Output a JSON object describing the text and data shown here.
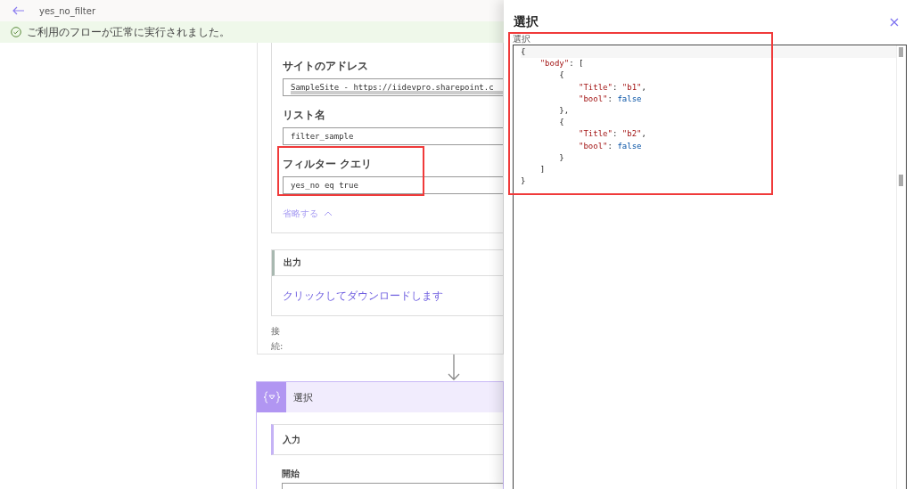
{
  "header": {
    "title": "yes_no_filter"
  },
  "banner": {
    "text": "ご利用のフローが正常に実行されました。"
  },
  "action_card": {
    "fields": [
      {
        "label": "サイトのアドレス",
        "value": "SampleSite - https://iidevpro.sharepoint.c",
        "highlighted": false,
        "scrollbar": true
      },
      {
        "label": "リスト名",
        "value": "filter_sample",
        "highlighted": false,
        "scrollbar": false
      },
      {
        "label": "フィルター クエリ",
        "value": "yes_no eq true",
        "highlighted": true,
        "scrollbar": false
      }
    ],
    "collapse_link": "省略する",
    "output": {
      "title": "出力",
      "link": "クリックしてダウンロードします"
    },
    "connection_label": "接続:"
  },
  "select_card": {
    "title": "選択",
    "input_title": "入力",
    "start_label": "開始"
  },
  "panel": {
    "title": "選択",
    "editor_label": "選択",
    "highlighted": true,
    "lines": [
      [
        {
          "kind": "punct",
          "text": "{"
        }
      ],
      [
        {
          "kind": "key",
          "text": "    \"body\""
        },
        {
          "kind": "punct",
          "text": ": ["
        }
      ],
      [
        {
          "kind": "punct",
          "text": "        {"
        }
      ],
      [
        {
          "kind": "key",
          "text": "            \"Title\""
        },
        {
          "kind": "punct",
          "text": ": "
        },
        {
          "kind": "key",
          "text": "\"b1\""
        },
        {
          "kind": "punct",
          "text": ","
        }
      ],
      [
        {
          "kind": "key",
          "text": "            \"bool\""
        },
        {
          "kind": "punct",
          "text": ": "
        },
        {
          "kind": "value",
          "text": "false"
        }
      ],
      [
        {
          "kind": "punct",
          "text": "        },"
        }
      ],
      [
        {
          "kind": "punct",
          "text": "        {"
        }
      ],
      [
        {
          "kind": "key",
          "text": "            \"Title\""
        },
        {
          "kind": "punct",
          "text": ": "
        },
        {
          "kind": "key",
          "text": "\"b2\""
        },
        {
          "kind": "punct",
          "text": ","
        }
      ],
      [
        {
          "kind": "key",
          "text": "            \"bool\""
        },
        {
          "kind": "punct",
          "text": ": "
        },
        {
          "kind": "value",
          "text": "false"
        }
      ],
      [
        {
          "kind": "punct",
          "text": "        }"
        }
      ],
      [
        {
          "kind": "punct",
          "text": "    ]"
        }
      ],
      [
        {
          "kind": "punct",
          "text": "}"
        }
      ]
    ]
  }
}
